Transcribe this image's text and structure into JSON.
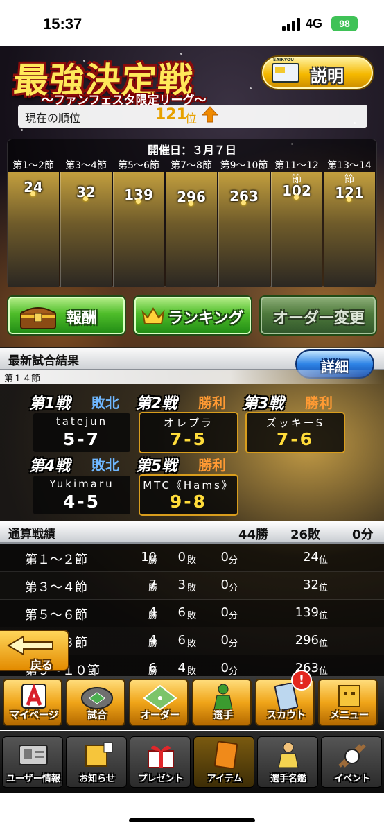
{
  "status_bar": {
    "time": "15:37",
    "network": "4G",
    "battery": "98"
  },
  "header": {
    "title": "最強決定戦",
    "subtitle": "〜ファンフェスタ限定リーグ〜",
    "explain_button": "説明",
    "explain_icon_text": "SAIKYOU",
    "rank_label": "現在の順位",
    "rank_value": "121",
    "rank_unit": "位",
    "rank_trend": "up"
  },
  "schedule": {
    "date_label": "開催日：３月７日",
    "rounds": [
      {
        "label": "第1〜2節",
        "rank": "24"
      },
      {
        "label": "第3〜4節",
        "rank": "32"
      },
      {
        "label": "第5〜6節",
        "rank": "139"
      },
      {
        "label": "第7〜8節",
        "rank": "296"
      },
      {
        "label": "第9〜10節",
        "rank": "263"
      },
      {
        "label": "第11〜12節",
        "rank": "102"
      },
      {
        "label": "第13〜14節",
        "rank": "121"
      }
    ]
  },
  "actions": {
    "reward": "報酬",
    "ranking": "ランキング",
    "order": "オーダー変更"
  },
  "latest": {
    "title": "最新試合結果",
    "detail_button": "詳細",
    "round": "第１４節",
    "games": [
      {
        "title": "第1戦",
        "result": "敗北",
        "opponent": "tatejun",
        "score": "5-7",
        "win": false
      },
      {
        "title": "第2戦",
        "result": "勝利",
        "opponent": "オレプラ",
        "score": "7-5",
        "win": true
      },
      {
        "title": "第3戦",
        "result": "勝利",
        "opponent": "ズッキーS",
        "score": "7-6",
        "win": true
      },
      {
        "title": "第4戦",
        "result": "敗北",
        "opponent": "Yukimaru",
        "score": "4-5",
        "win": false
      },
      {
        "title": "第5戦",
        "result": "勝利",
        "opponent": "MTC《Hams》",
        "score": "9-8",
        "win": true
      }
    ]
  },
  "cumulative": {
    "title": "通算戦績",
    "wins": "44勝",
    "losses": "26敗",
    "draws": "0分",
    "win_unit": "勝",
    "loss_unit": "敗",
    "draw_unit": "分",
    "rank_unit": "位",
    "rows": [
      {
        "name": "第１〜２節",
        "w": "10",
        "l": "0",
        "d": "0",
        "rank": "24"
      },
      {
        "name": "第３〜４節",
        "w": "7",
        "l": "3",
        "d": "0",
        "rank": "32"
      },
      {
        "name": "第５〜６節",
        "w": "4",
        "l": "6",
        "d": "0",
        "rank": "139"
      },
      {
        "name": "第７〜８節",
        "w": "4",
        "l": "6",
        "d": "0",
        "rank": "296"
      },
      {
        "name": "第９〜１０節",
        "w": "6",
        "l": "4",
        "d": "0",
        "rank": "263"
      }
    ]
  },
  "back_button": "戻る",
  "nav_main": [
    {
      "label": "マイページ",
      "icon": "mypage-icon"
    },
    {
      "label": "試合",
      "icon": "stadium-icon"
    },
    {
      "label": "オーダー",
      "icon": "field-order-icon"
    },
    {
      "label": "選手",
      "icon": "player-icon"
    },
    {
      "label": "スカウト",
      "icon": "scout-card-icon"
    },
    {
      "label": "メニュー",
      "icon": "menu-box-icon"
    }
  ],
  "scout_badge": "!",
  "nav_sub": [
    {
      "label": "ユーザー情報",
      "icon": "user-info-icon"
    },
    {
      "label": "お知らせ",
      "icon": "news-icon"
    },
    {
      "label": "プレゼント",
      "icon": "gift-icon"
    },
    {
      "label": "アイテム",
      "icon": "item-icon"
    },
    {
      "label": "選手名鑑",
      "icon": "player-book-icon"
    },
    {
      "label": "イベント",
      "icon": "event-bat-ball-icon"
    }
  ]
}
